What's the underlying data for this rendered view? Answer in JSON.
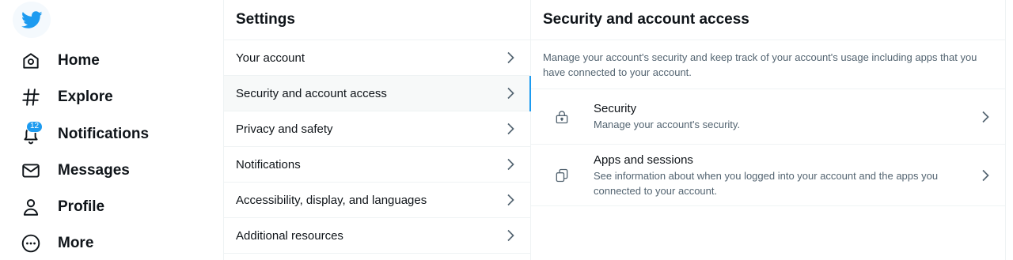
{
  "nav": {
    "items": [
      {
        "label": "Home",
        "icon": "home-icon"
      },
      {
        "label": "Explore",
        "icon": "hashtag-icon"
      },
      {
        "label": "Notifications",
        "icon": "bell-icon",
        "badge": "12"
      },
      {
        "label": "Messages",
        "icon": "envelope-icon"
      },
      {
        "label": "Profile",
        "icon": "person-icon"
      },
      {
        "label": "More",
        "icon": "more-circle-icon"
      }
    ]
  },
  "settings": {
    "title": "Settings",
    "items": [
      {
        "label": "Your account"
      },
      {
        "label": "Security and account access",
        "active": true
      },
      {
        "label": "Privacy and safety"
      },
      {
        "label": "Notifications"
      },
      {
        "label": "Accessibility, display, and languages"
      },
      {
        "label": "Additional resources"
      }
    ]
  },
  "detail": {
    "title": "Security and account access",
    "description": "Manage your account's security and keep track of your account's usage including apps that you have connected to your account.",
    "items": [
      {
        "title": "Security",
        "subtitle": "Manage your account's security.",
        "icon": "lock-icon"
      },
      {
        "title": "Apps and sessions",
        "subtitle": "See information about when you logged into your account and the apps you connected to your account.",
        "icon": "apps-icon"
      }
    ]
  },
  "colors": {
    "accent": "#1d9bf0",
    "text": "#0f1419",
    "secondary_text": "#536471",
    "border": "#eff3f4"
  }
}
